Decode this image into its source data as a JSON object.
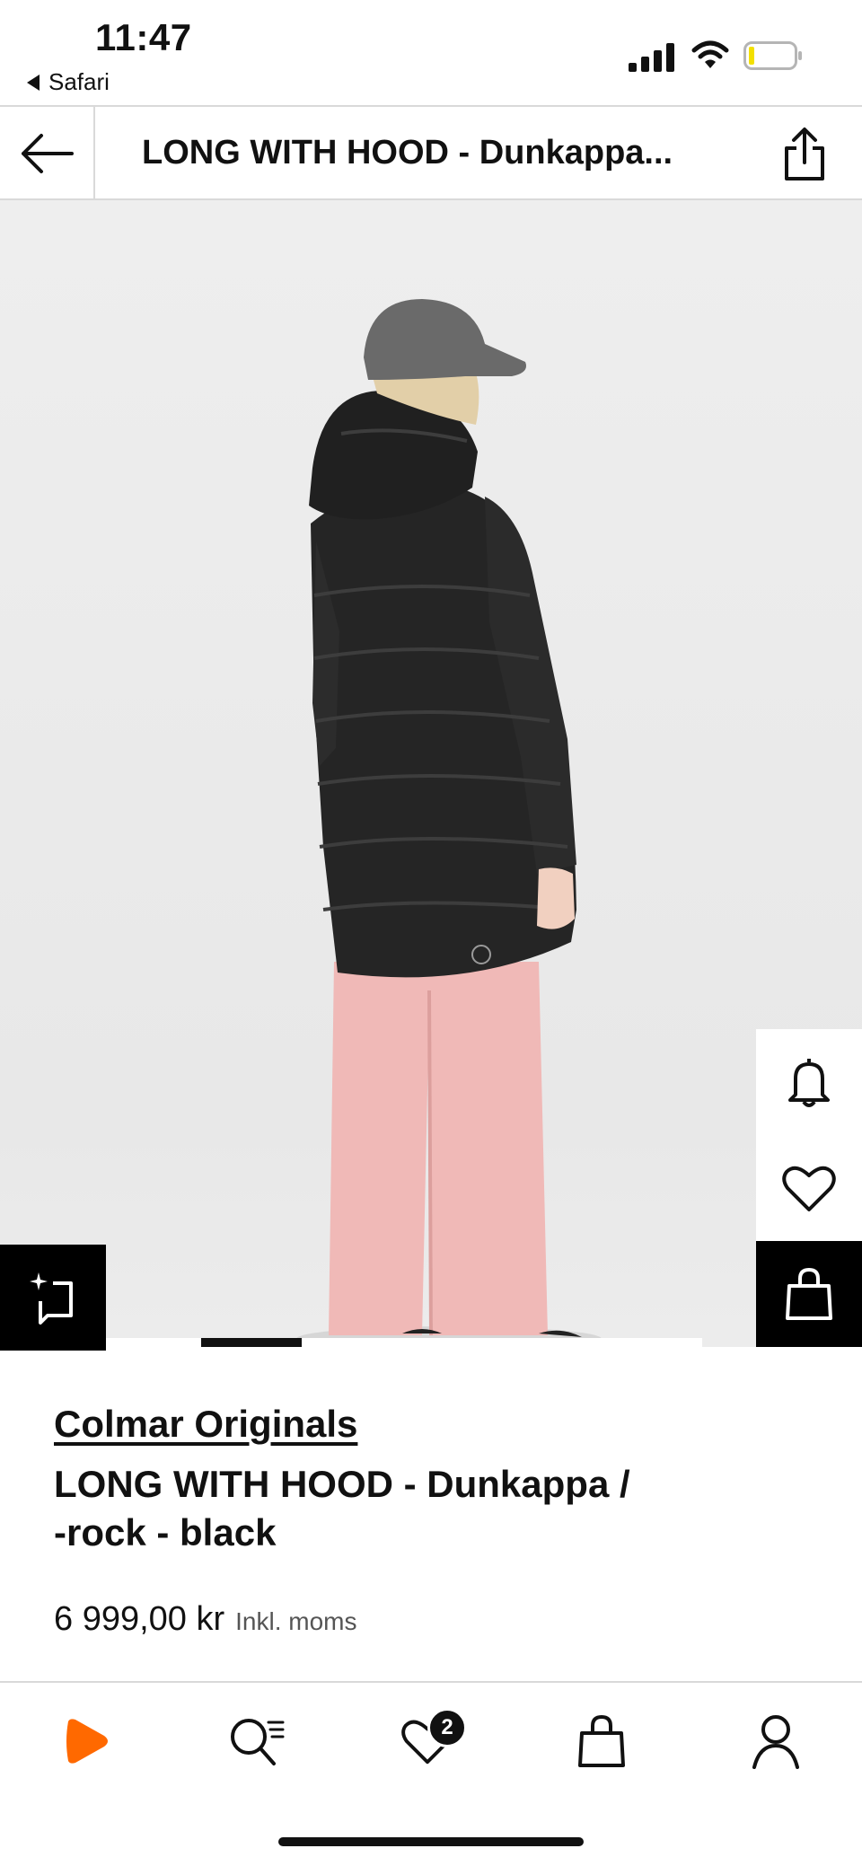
{
  "status_bar": {
    "time": "11:47",
    "back_app": "Safari"
  },
  "nav": {
    "title": "LONG WITH HOOD - Dunkappa..."
  },
  "product": {
    "brand": "Colmar Originals",
    "name_line1": "LONG WITH HOOD - Dunkappa /",
    "name_line2": "-rock - black",
    "price": "6 999,00 kr",
    "tax_note": "Inkl. moms"
  },
  "carousel": {
    "active_index": 1
  },
  "tab_bar": {
    "wishlist_badge": "2"
  },
  "icons": {
    "back": "arrow-left-icon",
    "share": "share-icon",
    "alert": "bell-icon",
    "wishlist": "heart-icon",
    "bag": "shopping-bag-icon",
    "similar": "sparkle-frame-icon",
    "home": "zalando-logo-icon",
    "search": "search-icon",
    "account": "user-icon"
  },
  "colors": {
    "brand_orange": "#ff6900",
    "text": "#111111",
    "image_bg": "#ececec",
    "jacket": "#222222",
    "pants": "#f0b9b7",
    "cap": "#6a6a6a"
  }
}
